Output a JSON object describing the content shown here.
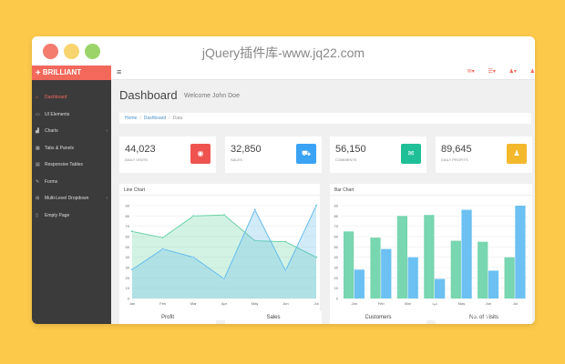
{
  "window": {
    "title": "jQuery插件库-www.jq22.com"
  },
  "colors": {
    "accent": "#f2685b",
    "visits": "#ef5350",
    "sales": "#3aa3f4",
    "comments": "#1fbf98",
    "profits": "#f4b82d",
    "sidebar": "#3b3b3b"
  },
  "brand": {
    "icon": "plane-icon",
    "name": "BRILLIANT"
  },
  "sidebar": {
    "items": [
      {
        "label": "Dashboard",
        "icon": "home-icon",
        "active": true
      },
      {
        "label": "UI Elements",
        "icon": "desktop-icon"
      },
      {
        "label": "Charts",
        "icon": "chart-icon",
        "chevron": "‹"
      },
      {
        "label": "Tabs & Panels",
        "icon": "qrcode-icon"
      },
      {
        "label": "Responsive Tables",
        "icon": "table-icon"
      },
      {
        "label": "Forms",
        "icon": "edit-icon"
      },
      {
        "label": "Multi-Level Dropdown",
        "icon": "sitemap-icon",
        "chevron": "‹"
      },
      {
        "label": "Empty Page",
        "icon": "file-icon"
      }
    ]
  },
  "header": {
    "title": "Dashboard",
    "subtitle": "Welcome John Doe"
  },
  "breadcrumb": {
    "items": [
      "Home",
      "Dashboard",
      "Data"
    ]
  },
  "stats": [
    {
      "value": "44,023",
      "label": "DAILY VISITS",
      "icon": "eye-icon"
    },
    {
      "value": "32,850",
      "label": "SALES",
      "icon": "cart-icon"
    },
    {
      "value": "56,150",
      "label": "COMMENTS",
      "icon": "comments-icon"
    },
    {
      "value": "89,645",
      "label": "DAILY PROFITS",
      "icon": "user-icon"
    }
  ],
  "bottom_cards": [
    "Profit",
    "Sales",
    "Customers",
    "No. of Visits"
  ],
  "chart_data": [
    {
      "type": "area",
      "title": "Line Chart",
      "categories": [
        "Jan",
        "Feb",
        "Mar",
        "Apr",
        "May",
        "Jun",
        "Jul"
      ],
      "ylim": [
        0,
        90
      ],
      "yticks": [
        0,
        10,
        20,
        30,
        40,
        50,
        60,
        70,
        80,
        90
      ],
      "series": [
        {
          "values": [
            65,
            59,
            80,
            81,
            56,
            55,
            40
          ],
          "color": "#5fcf9f"
        },
        {
          "values": [
            28,
            48,
            40,
            19,
            86,
            27,
            90
          ],
          "color": "#5bb7ea"
        }
      ]
    },
    {
      "type": "bar",
      "title": "Bar Chart",
      "categories": [
        "Jan",
        "Feb",
        "Mar",
        "Apr",
        "May",
        "Jun",
        "Jul"
      ],
      "ylim": [
        0,
        90
      ],
      "yticks": [
        0,
        10,
        20,
        30,
        40,
        50,
        60,
        70,
        80,
        90
      ],
      "series": [
        {
          "values": [
            65,
            59,
            80,
            81,
            56,
            55,
            40
          ],
          "color": "#78d6b0"
        },
        {
          "values": [
            28,
            48,
            40,
            19,
            86,
            27,
            90
          ],
          "color": "#6cc1f2"
        }
      ]
    }
  ]
}
